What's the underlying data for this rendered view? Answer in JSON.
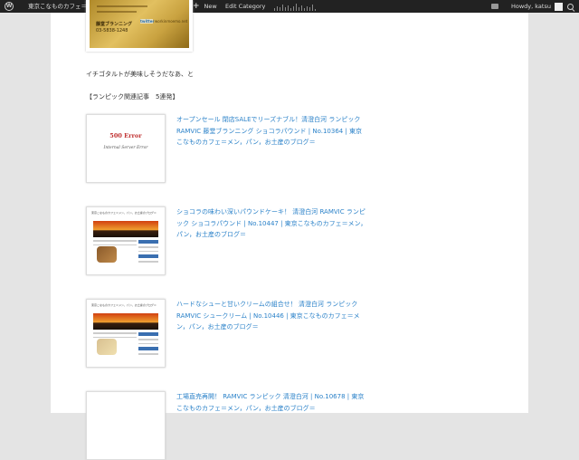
{
  "adminbar": {
    "site_title": "東京こなものカフェ＝メン，パン，お土産のブログ＝",
    "new_label": "New",
    "edit_label": "Edit Category",
    "howdy": "Howdy, katsu"
  },
  "card": {
    "line1": "藤堂ブランニング",
    "line2": "03-5838-1248",
    "twitter": "twitter",
    "url": "workinmoemo.net"
  },
  "content": {
    "paragraph": "イチゴタルトが美味しそうだなあ、と",
    "related_heading": "【ランピック関連記事　5連発】"
  },
  "posts": [
    {
      "link": "オープンセール 閉店SALEでリーズナブル！清澄白河 ランピック RAMVIC 藤堂ブランニング ショコラパウンド | No.10364 | 東京こなものカフェ＝メン，パン，お土産のブログ＝",
      "thumb_title": "500 Error",
      "thumb_sub": "Internal Server Error"
    },
    {
      "link": "ショコラの味わい深いパウンドケーキ！ 清澄白河 RAMVIC ランピック ショコラパウンド | No.10447 | 東京こなものカフェ＝メン，パン，お土産のブログ＝",
      "thumb_head": "東京こなものカフェ＝メン，パン，お土産のブログ＝"
    },
    {
      "link": "ハードなシューと甘いクリームの組合せ！ 清澄白河 ランピック RAMVIC シュークリーム | No.10446 | 東京こなものカフェ＝メン，パン，お土産のブログ＝",
      "thumb_head": "東京こなものカフェ＝メン，パン，お土産のブログ＝"
    },
    {
      "link": "工場直売再開！ RAMVIC ランピック 清澄白河 | No.10678 | 東京こなものカフェ＝メン，パン，お土産のブログ＝"
    }
  ],
  "colors": {
    "link": "#2b82c9",
    "adminbar": "#222222",
    "page_bg": "#e4e4e4"
  }
}
